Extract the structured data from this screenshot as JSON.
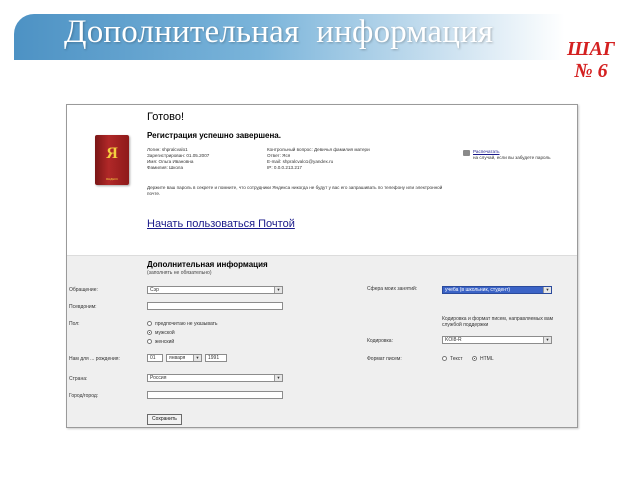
{
  "slide": {
    "title": "Дополнительная  информация",
    "step_label": "ШАГ",
    "step_number": "№ 6",
    "colors": {
      "title_bar": "#4d92c4",
      "step": "#d42020"
    }
  },
  "shot": {
    "ready_title": "Готово!",
    "reg_title": "Регистрация успешно завершена.",
    "book_letter": "Я",
    "book_caption": "ЯНДЕКС",
    "info_col1": [
      "Логин: shpralcvalo1",
      "Зарегистрирован: 01.05.2007",
      "Имя: Ольга Ивановна",
      "Фамилия: Школа"
    ],
    "info_col2": [
      "Контрольный вопрос: Девичья фамилия матери",
      "Ответ: Яся",
      "E-mail: shpralcvalo1@yandex.ru",
      "IP: 0.0.0.213.217"
    ],
    "print_link": "Распечатать",
    "print_note": "на случай, если вы забудете пароль",
    "note": "Держите ваш пароль в секрете и помните, что сотрудники Яндекса никогда не будут у вас его запрашивать по телефону или электронной почте.",
    "start_link": "Начать пользоваться Почтой",
    "additional": {
      "title": "Дополнительная информация",
      "subtitle": "(заполнять не обязательно)",
      "labels": {
        "salutation": "Обращение:",
        "position": "Псевдоним:",
        "gender": "Пол:",
        "birth": "Нам для ... рождения:",
        "country": "Страна:",
        "city": "Город/город:",
        "occupation": "Сфера моих занятий:",
        "encoding_note": "Кодировка и формат писем, направляемых вам службой поддержки",
        "encoding": "Кодировка:",
        "format": "Формат писем:"
      },
      "values": {
        "salutation": "Сэр",
        "occupation": "учеба (в школьник, студент)",
        "encoding": "KOI8-R",
        "birth_day": "01",
        "birth_month": "января",
        "birth_year": "1991",
        "country": "Россия"
      },
      "gender_options": [
        "предпочитаю не указывать",
        "мужской",
        "женский"
      ],
      "format_options": [
        "Текст",
        "HTML"
      ],
      "submit_label": "Сохранить"
    }
  }
}
